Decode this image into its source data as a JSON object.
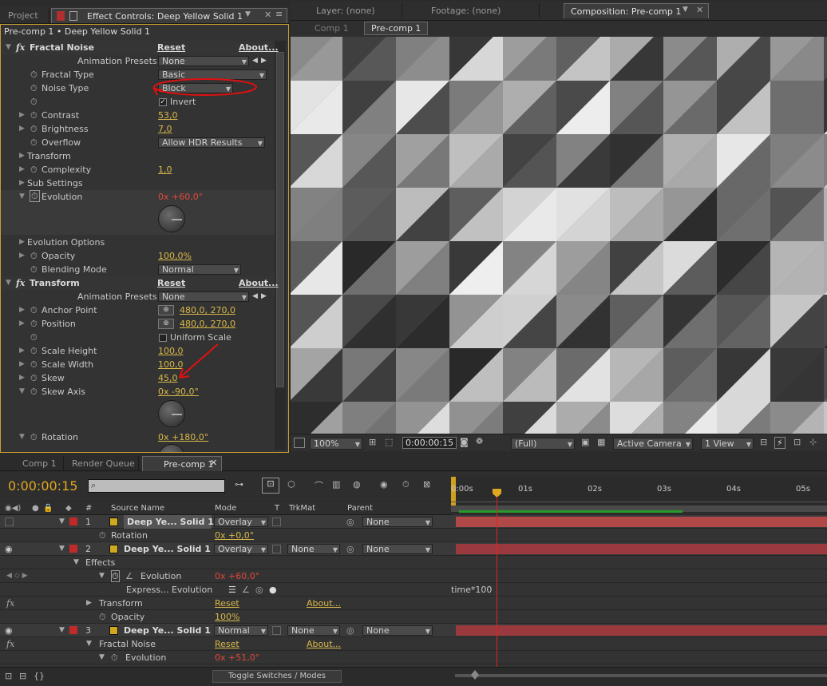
{
  "left_tabs": {
    "project": "Project",
    "effect_controls": "Effect Controls: Deep Yellow Solid 1"
  },
  "right_tabs": {
    "layer": "Layer: (none)",
    "footage": "Footage: (none)",
    "composition": "Composition: Pre-comp 1"
  },
  "comp_breadcrumbs": [
    "Comp 1",
    "Pre-comp 1"
  ],
  "effect_controls": {
    "crumb": "Pre-comp 1 • Deep Yellow Solid 1",
    "fractal_noise": {
      "name": "Fractal Noise",
      "reset": "Reset",
      "about": "About...",
      "animation_presets_label": "Animation Presets:",
      "animation_presets_value": "None",
      "fractal_type_label": "Fractal Type",
      "fractal_type_value": "Basic",
      "noise_type_label": "Noise Type",
      "noise_type_value": "Block",
      "invert_label": "Invert",
      "contrast_label": "Contrast",
      "contrast_value": "53,0",
      "brightness_label": "Brightness",
      "brightness_value": "7,0",
      "overflow_label": "Overflow",
      "overflow_value": "Allow HDR Results",
      "transform_label": "Transform",
      "complexity_label": "Complexity",
      "complexity_value": "1,0",
      "sub_settings_label": "Sub Settings",
      "evolution_label": "Evolution",
      "evolution_value": "0x +60,0°",
      "evolution_options_label": "Evolution Options",
      "opacity_label": "Opacity",
      "opacity_value": "100,0%",
      "blending_mode_label": "Blending Mode",
      "blending_mode_value": "Normal"
    },
    "transform": {
      "name": "Transform",
      "reset": "Reset",
      "about": "About...",
      "animation_presets_label": "Animation Presets:",
      "animation_presets_value": "None",
      "anchor_point_label": "Anchor Point",
      "anchor_point_value": "480,0, 270,0",
      "position_label": "Position",
      "position_value": "480,0, 270,0",
      "uniform_scale_label": "Uniform Scale",
      "scale_height_label": "Scale Height",
      "scale_height_value": "100,0",
      "scale_width_label": "Scale Width",
      "scale_width_value": "100,0",
      "skew_label": "Skew",
      "skew_value": "45,0",
      "skew_axis_label": "Skew Axis",
      "skew_axis_value": "0x -90,0°",
      "rotation_label": "Rotation",
      "rotation_value": "0x +180,0°"
    }
  },
  "viewer_bar": {
    "zoom": "100%",
    "timecode": "0:00:00:15",
    "resolution": "(Full)",
    "camera": "Active Camera",
    "views": "1 View"
  },
  "bottom_tabs": {
    "comp1": "Comp 1",
    "render_queue": "Render Queue",
    "precomp": "Pre-comp 1"
  },
  "timeline": {
    "timecode": "0:00:00:15",
    "columns": {
      "source_name": "Source Name",
      "mode": "Mode",
      "t": "T",
      "trkmat": "TrkMat",
      "parent": "Parent",
      "num": "#"
    },
    "ruler": [
      "0:00s",
      "01s",
      "02s",
      "03s",
      "04s",
      "05s"
    ],
    "layer1": {
      "num": "1",
      "name": "Deep Ye... Solid 1",
      "mode": "Overlay",
      "parent": "None",
      "rotation_label": "Rotation",
      "rotation_value": "0x +0,0°"
    },
    "layer2": {
      "num": "2",
      "name": "Deep Ye... Solid 1",
      "mode": "Overlay",
      "trkmat": "None",
      "parent": "None",
      "effects_label": "Effects",
      "evolution_label": "Evolution",
      "evolution_value": "0x +60,0°",
      "expression_label": "Express... Evolution",
      "expression_text": "time*100",
      "transform_label": "Transform",
      "reset": "Reset",
      "about": "About...",
      "opacity_label": "Opacity",
      "opacity_value": "100%"
    },
    "layer3": {
      "num": "3",
      "name": "Deep Ye... Solid 1",
      "mode": "Normal",
      "trkmat": "None",
      "parent": "None",
      "fractal_label": "Fractal Noise",
      "reset": "Reset",
      "about": "About...",
      "evolution_label": "Evolution",
      "evolution_value": "0x +51,0°"
    },
    "toggle_label": "Toggle Switches / Modes"
  },
  "colors": {
    "accent_gold": "#d9b84a",
    "keyframe_red": "#e04a3a",
    "layer_bar": "#9b3a3e",
    "annotation_red": "#e01010"
  }
}
